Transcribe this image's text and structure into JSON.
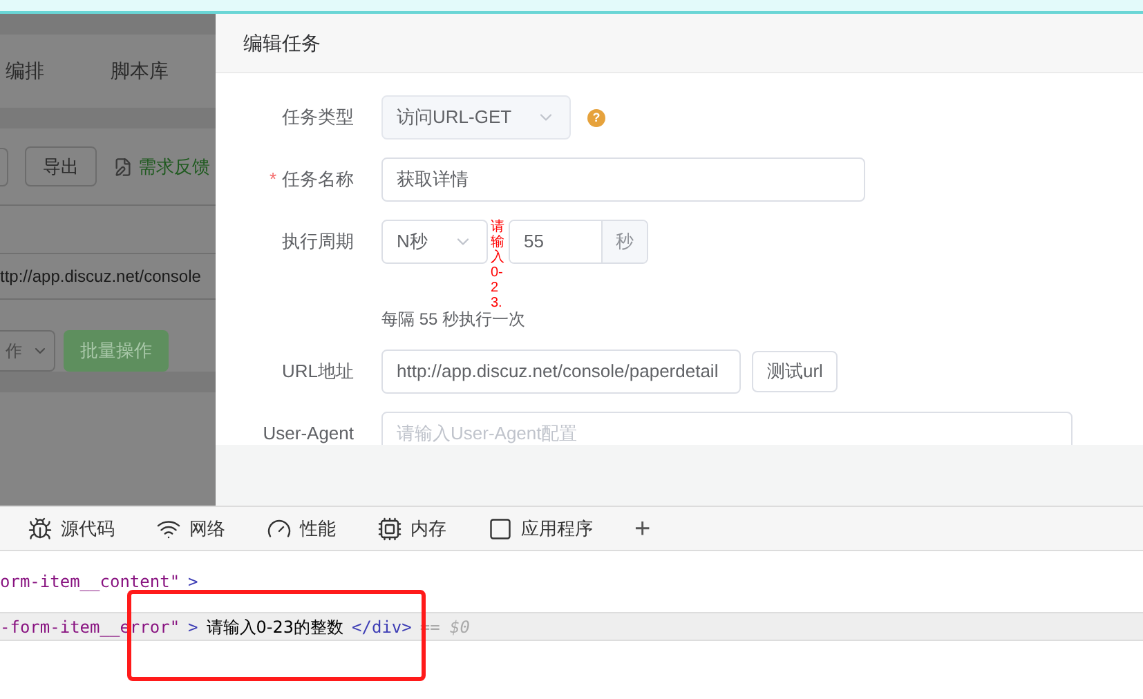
{
  "background_page": {
    "tabs": [
      "编排",
      "脚本库"
    ],
    "toolbar": [
      {
        "label": "导出",
        "kind": "button"
      },
      {
        "label": "需求反馈",
        "kind": "link"
      }
    ],
    "url": "ttp://app.discuz.net/console",
    "select": "作",
    "batch_button": "批量操作"
  },
  "dialog": {
    "title": "编辑任务",
    "fields": [
      {
        "kind": "select",
        "label": "任务类型",
        "value": "访问URL-GET",
        "disabled": true,
        "help": "?"
      },
      {
        "kind": "input",
        "label": "任务名称",
        "required_mark": "*",
        "value": "获取详情"
      },
      {
        "kind": "period",
        "label": "执行周期",
        "unit_select": "N秒",
        "error": "请输入0-23.",
        "value": "55",
        "suffix": "秒",
        "hint": "每隔 55 秒执行一次"
      },
      {
        "kind": "url",
        "label": "URL地址",
        "value": "http://app.discuz.net/console/paperdetail",
        "button": "测试url"
      },
      {
        "kind": "input",
        "label": "User-Agent",
        "placeholder": "请输入User-Agent配置"
      }
    ]
  },
  "devtools": {
    "tabs": [
      {
        "label": "源代码",
        "kind": "tab"
      },
      {
        "label": "网络",
        "kind": "tab"
      },
      {
        "label": "性能",
        "kind": "tab"
      },
      {
        "label": "内存",
        "kind": "tab"
      },
      {
        "label": "应用程序",
        "kind": "tab"
      },
      {
        "label": "+",
        "kind": "add"
      }
    ],
    "code_lines": [
      {
        "highlighted": false,
        "segments": [
          {
            "kind": "attr",
            "text": "orm-item__content\""
          },
          {
            "kind": "tag",
            "text": ">"
          }
        ]
      },
      {
        "highlighted": true,
        "segments": [
          {
            "kind": "attr",
            "text": "-form-item__error\""
          },
          {
            "kind": "tag",
            "text": ">"
          },
          {
            "kind": "text",
            "text": "请输入0-23的整数"
          },
          {
            "kind": "tag",
            "text": "</div>"
          },
          {
            "kind": "ref",
            "text": "== $0"
          }
        ]
      }
    ]
  }
}
